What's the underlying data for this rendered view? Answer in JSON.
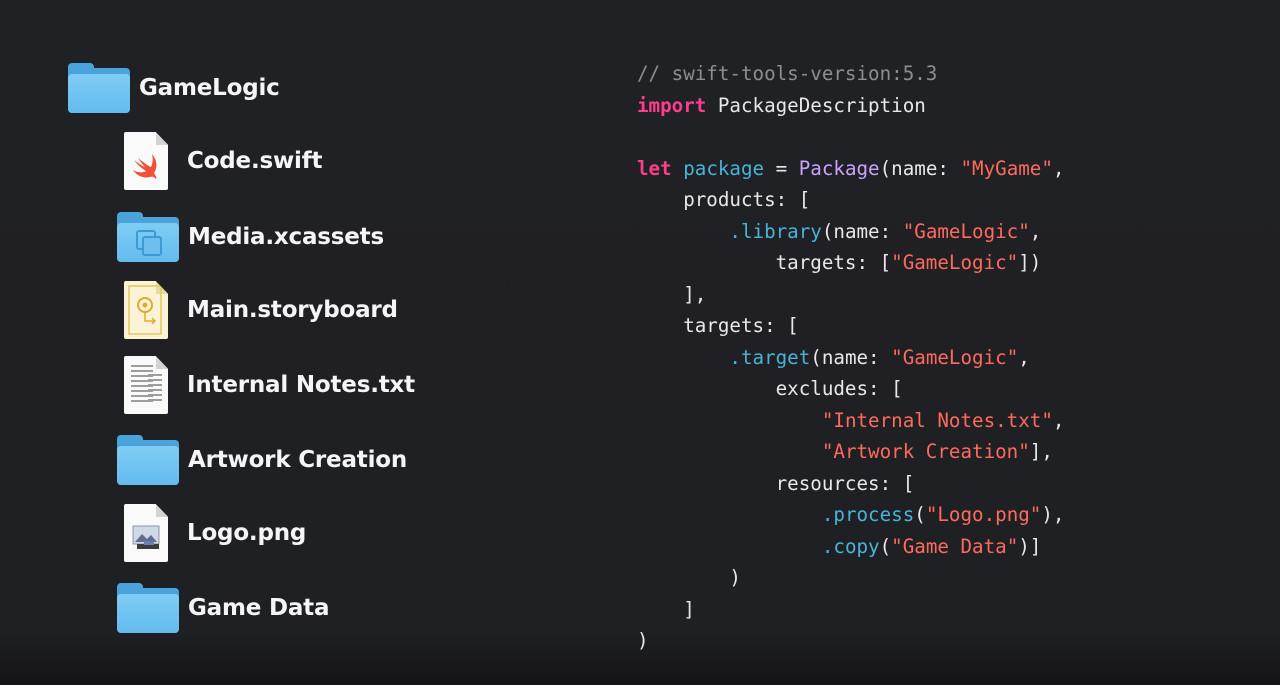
{
  "tree": {
    "root": {
      "name": "GameLogic",
      "icon": "folder-icon"
    },
    "children": [
      {
        "name": "Code.swift",
        "icon": "swift-file-icon"
      },
      {
        "name": "Media.xcassets",
        "icon": "asset-catalog-icon"
      },
      {
        "name": "Main.storyboard",
        "icon": "storyboard-file-icon"
      },
      {
        "name": "Internal Notes.txt",
        "icon": "text-file-icon"
      },
      {
        "name": "Artwork Creation",
        "icon": "folder-icon"
      },
      {
        "name": "Logo.png",
        "icon": "image-file-icon"
      },
      {
        "name": "Game Data",
        "icon": "folder-icon"
      }
    ]
  },
  "code": {
    "lines": [
      [
        {
          "t": "// swift-tools-version:5.3",
          "k": "comment"
        }
      ],
      [
        {
          "t": "import",
          "k": "kw"
        },
        {
          "t": " PackageDescription",
          "k": "plain"
        }
      ],
      [],
      [
        {
          "t": "let",
          "k": "kw"
        },
        {
          "t": " ",
          "k": "plain"
        },
        {
          "t": "package",
          "k": "ident"
        },
        {
          "t": " = ",
          "k": "plain"
        },
        {
          "t": "Package",
          "k": "type"
        },
        {
          "t": "(name: ",
          "k": "plain"
        },
        {
          "t": "\"MyGame\"",
          "k": "str"
        },
        {
          "t": ",",
          "k": "plain"
        }
      ],
      [
        {
          "t": "    products: [",
          "k": "plain"
        }
      ],
      [
        {
          "t": "        ",
          "k": "plain"
        },
        {
          "t": ".library",
          "k": "ident"
        },
        {
          "t": "(name: ",
          "k": "plain"
        },
        {
          "t": "\"GameLogic\"",
          "k": "str"
        },
        {
          "t": ",",
          "k": "plain"
        }
      ],
      [
        {
          "t": "            targets: [",
          "k": "plain"
        },
        {
          "t": "\"GameLogic\"",
          "k": "str"
        },
        {
          "t": "])",
          "k": "plain"
        }
      ],
      [
        {
          "t": "    ],",
          "k": "plain"
        }
      ],
      [
        {
          "t": "    targets: [",
          "k": "plain"
        }
      ],
      [
        {
          "t": "        ",
          "k": "plain"
        },
        {
          "t": ".target",
          "k": "ident"
        },
        {
          "t": "(name: ",
          "k": "plain"
        },
        {
          "t": "\"GameLogic\"",
          "k": "str"
        },
        {
          "t": ",",
          "k": "plain"
        }
      ],
      [
        {
          "t": "            excludes: [",
          "k": "plain"
        }
      ],
      [
        {
          "t": "                ",
          "k": "plain"
        },
        {
          "t": "\"Internal Notes.txt\"",
          "k": "str"
        },
        {
          "t": ",",
          "k": "plain"
        }
      ],
      [
        {
          "t": "                ",
          "k": "plain"
        },
        {
          "t": "\"Artwork Creation\"",
          "k": "str"
        },
        {
          "t": "],",
          "k": "plain"
        }
      ],
      [
        {
          "t": "            resources: [",
          "k": "plain"
        }
      ],
      [
        {
          "t": "                ",
          "k": "plain"
        },
        {
          "t": ".process",
          "k": "ident"
        },
        {
          "t": "(",
          "k": "plain"
        },
        {
          "t": "\"Logo.png\"",
          "k": "str"
        },
        {
          "t": "),",
          "k": "plain"
        }
      ],
      [
        {
          "t": "                ",
          "k": "plain"
        },
        {
          "t": ".copy",
          "k": "ident"
        },
        {
          "t": "(",
          "k": "plain"
        },
        {
          "t": "\"Game Data\"",
          "k": "str"
        },
        {
          "t": ")]",
          "k": "plain"
        }
      ],
      [
        {
          "t": "        )",
          "k": "plain"
        }
      ],
      [
        {
          "t": "    ]",
          "k": "plain"
        }
      ],
      [
        {
          "t": ")",
          "k": "plain"
        }
      ]
    ]
  },
  "colors": {
    "keyword": "#ff3d8e",
    "identifier": "#47b4d8",
    "type": "#c9a3ff",
    "string": "#ff6a5e",
    "comment": "#8a8f96",
    "folder": "#6bc0ef"
  }
}
